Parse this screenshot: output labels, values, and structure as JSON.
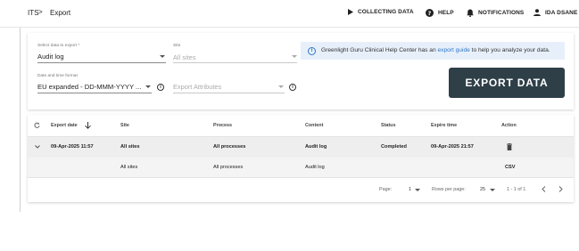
{
  "breadcrumb": {
    "root": "ITS",
    "separator": ">",
    "current": "Export"
  },
  "nav": {
    "collecting": "COLLECTING DATA",
    "help": "HELP",
    "notifications": "NOTIFICATIONS",
    "user": "IDA DSANE"
  },
  "form": {
    "select_label": "Select data to export *",
    "select_value": "Audit log",
    "site_label": "Site",
    "site_placeholder": "All sites",
    "datetime_label": "Date and time format",
    "datetime_value": "EU expanded - DD-MMM-YYYY ...",
    "attributes_placeholder": "Export Attributes"
  },
  "info": {
    "text_before": "Greenlight Guru Clinical Help Center has an ",
    "link": "export guide",
    "text_after": " to help you analyze your data."
  },
  "export_button": "EXPORT DATA",
  "table": {
    "headers": [
      "Export date",
      "Site",
      "Process",
      "Content",
      "Status",
      "Expire time",
      "Action"
    ],
    "row1": {
      "date": "09-Apr-2025 11:57",
      "site": "All sites",
      "process": "All processes",
      "content": "Audit log",
      "status": "Completed",
      "expire": "09-Apr-2025 21:57"
    },
    "row2": {
      "site": "All sites",
      "process": "All processes",
      "content": "Audit log",
      "action": "CSV"
    }
  },
  "pagination": {
    "page_label": "Page:",
    "page_value": "1",
    "rows_label": "Rows per page:",
    "rows_value": "25",
    "range": "1 - 1 of 1"
  }
}
